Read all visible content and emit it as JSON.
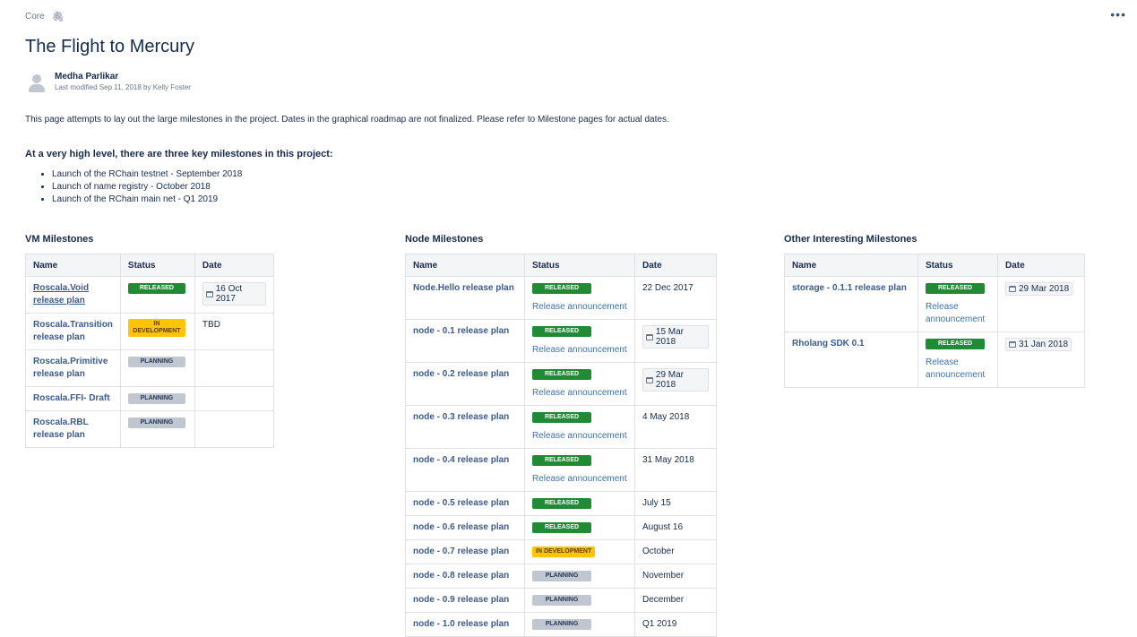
{
  "breadcrumb": "Core",
  "more_menu": "•••",
  "title": "The Flight to Mercury",
  "author": "Medha Parlikar",
  "last_modified": "Last modified Sep 11, 2018 by Kelly Foster",
  "intro": "This page attempts to lay out the large milestones in the project.  Dates in the graphical roadmap are not finalized.  Please refer to Milestone pages for actual dates.",
  "highlight_heading": "At a very high level, there are three key milestones in this project:",
  "key_milestones": [
    "Launch of the RChain testnet - September 2018",
    "Launch of name registry - October 2018",
    "Launch of the RChain main net - Q1 2019"
  ],
  "columns": {
    "name": "Name",
    "status": "Status",
    "date": "Date"
  },
  "status_labels": {
    "released": "RELEASED",
    "in_dev": "IN DEVELOPMENT",
    "planning": "PLANNING"
  },
  "release_announcement": "Release announcement",
  "vm": {
    "heading": "VM Milestones",
    "rows": [
      {
        "name": "Roscala.Void release plan",
        "date": "16 Oct 2017"
      },
      {
        "name": "Roscala.Transition release plan",
        "date": "TBD"
      },
      {
        "name": "Roscala.Primitive release plan"
      },
      {
        "name": "Roscala.FFI- Draft"
      },
      {
        "name": "Roscala.RBL release plan"
      }
    ]
  },
  "node": {
    "heading": "Node Milestones",
    "rows": [
      {
        "name": "Node.Hello release plan",
        "date": "22 Dec 2017"
      },
      {
        "name": "node - 0.1 release plan",
        "date": "15 Mar 2018"
      },
      {
        "name": "node - 0.2 release plan",
        "date": "29 Mar 2018"
      },
      {
        "name": "node - 0.3 release plan",
        "date": "4 May 2018"
      },
      {
        "name": "node - 0.4 release plan",
        "date": "31 May 2018"
      },
      {
        "name": "node - 0.5 release plan",
        "date": "July 15"
      },
      {
        "name": "node - 0.6 release plan",
        "date": "August 16"
      },
      {
        "name": "node - 0.7 release plan",
        "date": "October"
      },
      {
        "name": "node - 0.8 release plan",
        "date": "November"
      },
      {
        "name": "node - 0.9 release plan",
        "date": "December"
      },
      {
        "name": "node - 1.0 release plan",
        "date": "Q1 2019"
      }
    ]
  },
  "other": {
    "heading": "Other Interesting Milestones",
    "rows": [
      {
        "name": "storage - 0.1.1 release plan",
        "date": "29 Mar 2018",
        "link": "Release announcement"
      },
      {
        "name": "Rholang SDK 0.1",
        "date": "31 Jan 2018",
        "link": "Release announcement"
      }
    ]
  },
  "colors": {
    "released": "#218a35",
    "in_dev": "#ffc400",
    "planning": "#c1c7d0",
    "link": "#3b5b8c"
  }
}
